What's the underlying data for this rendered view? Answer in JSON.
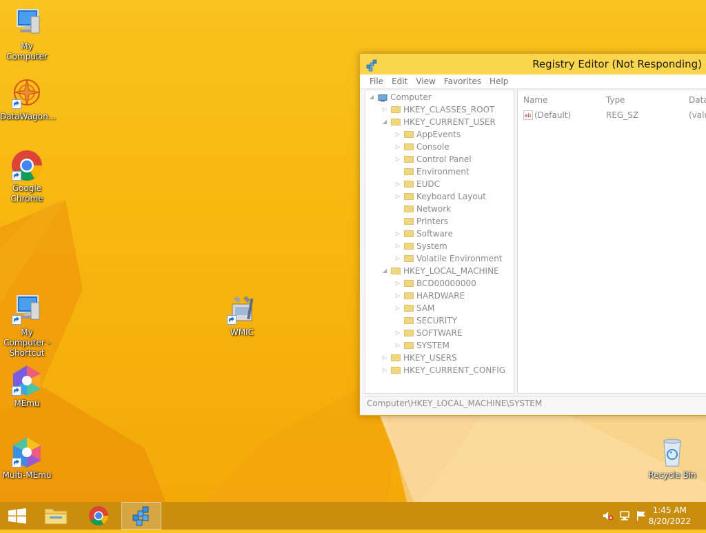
{
  "desktop": {
    "icons": [
      {
        "label": "My Computer"
      },
      {
        "label": "DataWagon..."
      },
      {
        "label": "Google Chrome"
      },
      {
        "label": "My Computer - Shortcut"
      },
      {
        "label": "MEmu"
      },
      {
        "label": "Multi-MEmu"
      },
      {
        "label": "WMIC"
      },
      {
        "label": "Recycle Bin"
      }
    ]
  },
  "regedit": {
    "title": "Registry Editor (Not Responding)",
    "menu": [
      "File",
      "Edit",
      "View",
      "Favorites",
      "Help"
    ],
    "tree": [
      {
        "label": "Computer",
        "level": 0,
        "expander": "expanded"
      },
      {
        "label": "HKEY_CLASSES_ROOT",
        "level": 1,
        "expander": "collapsed"
      },
      {
        "label": "HKEY_CURRENT_USER",
        "level": 1,
        "expander": "expanded"
      },
      {
        "label": "AppEvents",
        "level": 2,
        "expander": "collapsed"
      },
      {
        "label": "Console",
        "level": 2,
        "expander": "collapsed"
      },
      {
        "label": "Control Panel",
        "level": 2,
        "expander": "collapsed"
      },
      {
        "label": "Environment",
        "level": 2,
        "expander": "none"
      },
      {
        "label": "EUDC",
        "level": 2,
        "expander": "collapsed"
      },
      {
        "label": "Keyboard Layout",
        "level": 2,
        "expander": "collapsed"
      },
      {
        "label": "Network",
        "level": 2,
        "expander": "none"
      },
      {
        "label": "Printers",
        "level": 2,
        "expander": "none"
      },
      {
        "label": "Software",
        "level": 2,
        "expander": "collapsed"
      },
      {
        "label": "System",
        "level": 2,
        "expander": "collapsed"
      },
      {
        "label": "Volatile Environment",
        "level": 2,
        "expander": "collapsed"
      },
      {
        "label": "HKEY_LOCAL_MACHINE",
        "level": 1,
        "expander": "expanded"
      },
      {
        "label": "BCD00000000",
        "level": 2,
        "expander": "collapsed"
      },
      {
        "label": "HARDWARE",
        "level": 2,
        "expander": "collapsed"
      },
      {
        "label": "SAM",
        "level": 2,
        "expander": "collapsed"
      },
      {
        "label": "SECURITY",
        "level": 2,
        "expander": "none"
      },
      {
        "label": "SOFTWARE",
        "level": 2,
        "expander": "collapsed"
      },
      {
        "label": "SYSTEM",
        "level": 2,
        "expander": "collapsed"
      },
      {
        "label": "HKEY_USERS",
        "level": 1,
        "expander": "collapsed"
      },
      {
        "label": "HKEY_CURRENT_CONFIG",
        "level": 1,
        "expander": "collapsed"
      }
    ],
    "columns": {
      "name": "Name",
      "type": "Type",
      "data": "Data"
    },
    "values": [
      {
        "name": "(Default)",
        "type": "REG_SZ",
        "data": "(valu"
      }
    ],
    "status_path": "Computer\\HKEY_LOCAL_MACHINE\\SYSTEM"
  },
  "taskbar": {
    "time": "1:45 AM",
    "date": "8/20/2022"
  },
  "colors": {
    "wallpaper": "#f8b80e",
    "titlebar": "#fbd54c",
    "taskbar": "#c48a10"
  }
}
